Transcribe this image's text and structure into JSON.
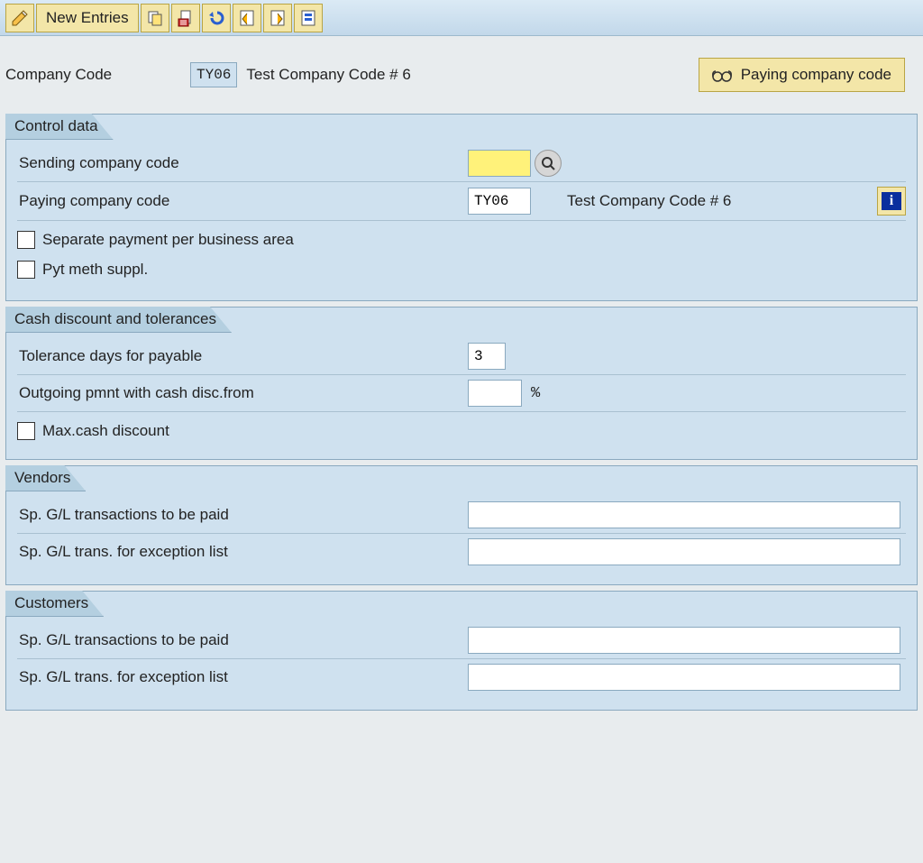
{
  "toolbar": {
    "new_entries_label": "New Entries"
  },
  "header": {
    "company_code_label": "Company Code",
    "company_code_value": "TY06",
    "company_code_desc": "Test Company Code # 6",
    "paying_cc_btn_label": "Paying company code"
  },
  "groups": {
    "control": {
      "title": "Control data",
      "sending_cc_label": "Sending company code",
      "sending_cc_value": "",
      "paying_cc_label": "Paying company code",
      "paying_cc_value": "TY06",
      "paying_cc_desc": "Test Company Code # 6",
      "separate_payment_label": "Separate payment per business area",
      "pyt_meth_suppl_label": "Pyt meth suppl."
    },
    "cash": {
      "title": "Cash discount and tolerances",
      "tolerance_days_label": "Tolerance days for payable",
      "tolerance_days_value": "3",
      "outgoing_pmnt_label": "Outgoing pmnt with cash disc.from",
      "outgoing_pmnt_value": "",
      "outgoing_pmnt_unit": "%",
      "max_cash_disc_label": "Max.cash discount"
    },
    "vendors": {
      "title": "Vendors",
      "sp_gl_paid_label": "Sp. G/L transactions to be paid",
      "sp_gl_paid_value": "",
      "sp_gl_exc_label": "Sp. G/L trans. for exception list",
      "sp_gl_exc_value": ""
    },
    "customers": {
      "title": "Customers",
      "sp_gl_paid_label": "Sp. G/L transactions to be paid",
      "sp_gl_paid_value": "",
      "sp_gl_exc_label": "Sp. G/L trans. for exception list",
      "sp_gl_exc_value": ""
    }
  }
}
